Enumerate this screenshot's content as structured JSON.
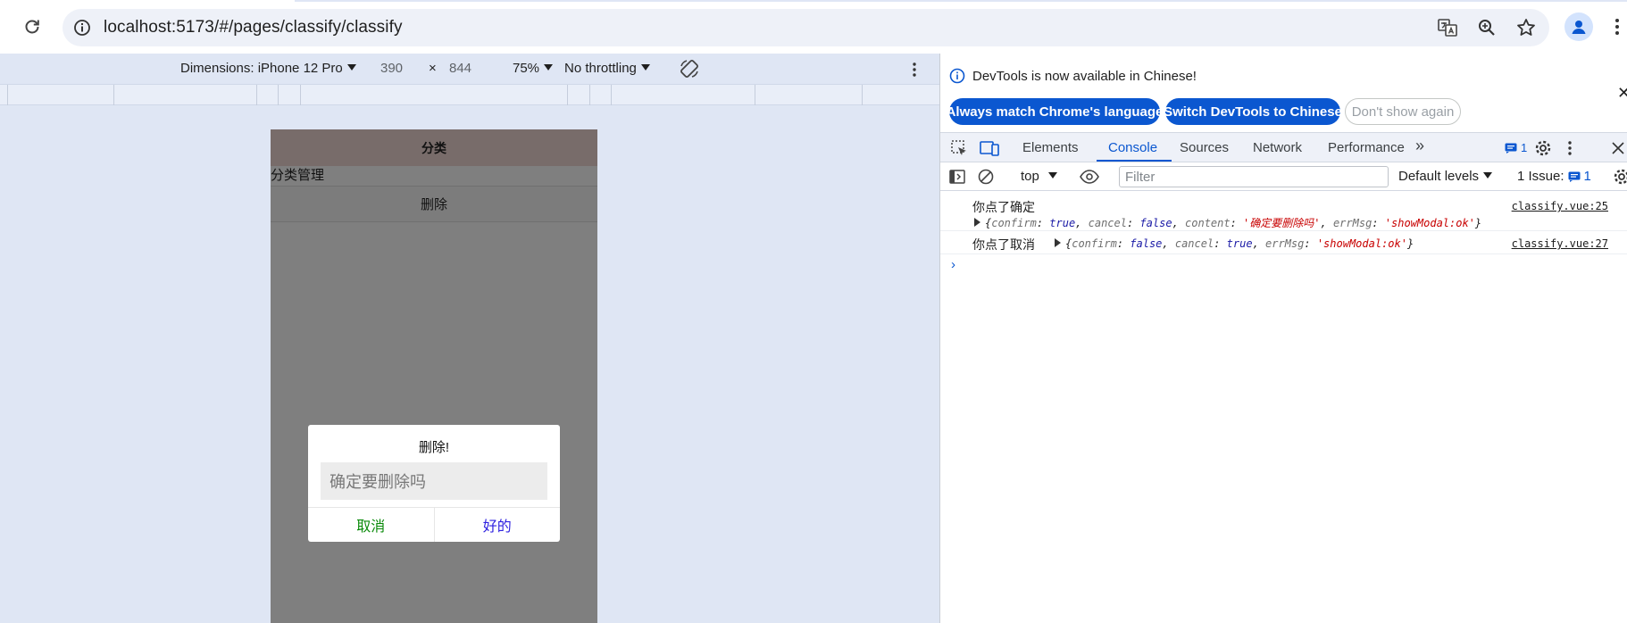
{
  "browser": {
    "url": "localhost:5173/#/pages/classify/classify",
    "icons": [
      "reload-icon",
      "site-info-icon",
      "translate-icon",
      "zoom-icon",
      "bookmark-star-icon",
      "profile-icon",
      "chrome-menu-icon"
    ]
  },
  "device_toolbar": {
    "dimensions_label": "Dimensions: iPhone 12 Pro",
    "width": "390",
    "times": "×",
    "height": "844",
    "zoom": "75%",
    "throttling": "No throttling"
  },
  "phone": {
    "nav_title": "分类",
    "page_label": "分类管理",
    "delete_button": "删除",
    "modal": {
      "title": "删除!",
      "input_value": "确定要删除吗",
      "cancel": "取消",
      "confirm": "好的",
      "cancel_color": "#0a8a0a",
      "confirm_color": "#2f22e0"
    }
  },
  "devtools": {
    "infobar": {
      "message": "DevTools is now available in Chinese!",
      "btn_match": "Always match Chrome's language",
      "btn_switch": "Switch DevTools to Chinese",
      "btn_dismiss": "Don't show again"
    },
    "tabs": [
      "Elements",
      "Console",
      "Sources",
      "Network",
      "Performance"
    ],
    "active_tab": "Console",
    "more_tabs": "»",
    "issues_badge": "1",
    "console_toolbar": {
      "context": "top",
      "filter_placeholder": "Filter",
      "levels": "Default levels",
      "issues_label": "1 Issue:",
      "issues_count": "1"
    },
    "logs": [
      {
        "text": "你点了确定",
        "source": "classify.vue:25",
        "object": {
          "open": "{",
          "k1": "confirm",
          "v1": "true",
          "k2": "cancel",
          "v2": "false",
          "k3": "content",
          "v3": "'确定要删除吗'",
          "k4": "errMsg",
          "v4": "'showModal:ok'",
          "close": "}"
        }
      },
      {
        "text": "你点了取消",
        "source": "classify.vue:27",
        "object": {
          "open": "{",
          "k1": "confirm",
          "v1": "false",
          "k2": "cancel",
          "v2": "true",
          "k3": "errMsg",
          "v3": "'showModal:ok'",
          "close": "}"
        }
      }
    ],
    "prompt": "›"
  }
}
